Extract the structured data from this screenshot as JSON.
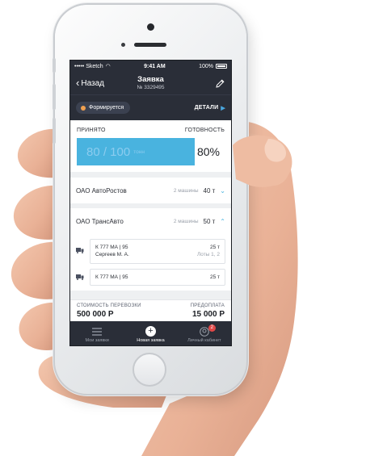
{
  "status_bar": {
    "carrier": "••••• Sketch",
    "time": "9:41 AM",
    "battery": "100%"
  },
  "nav": {
    "back_label": "Назад",
    "title": "Заявка",
    "subtitle": "№ 3329495"
  },
  "status_pill": {
    "label": "Формируется",
    "dot_color": "#f0a050"
  },
  "details_label": "ДЕТАЛИ",
  "summary": {
    "accepted_label": "ПРИНЯТО",
    "ready_label": "ГОТОВНОСТЬ",
    "progress_text": "80 / 100",
    "progress_unit": "тонн",
    "progress_percent": "80%",
    "progress_fraction": 0.8
  },
  "carriers": [
    {
      "name": "ОАО АвтоРостов",
      "count": "2 машины",
      "weight": "40 т",
      "expanded": false
    },
    {
      "name": "ОАО ТрансАвто",
      "count": "2 машины",
      "weight": "50 т",
      "expanded": true
    }
  ],
  "trucks": [
    {
      "plate": "К 777 МА | 95",
      "driver": "Сергеев М. А.",
      "weight": "25 т",
      "lots": "Лоты 1, 2"
    },
    {
      "plate": "К 777 МА | 95",
      "driver": "",
      "weight": "25 т",
      "lots": ""
    }
  ],
  "footer": {
    "cost_label": "СТОИМОСТЬ ПЕРЕВОЗКИ",
    "prepay_label": "ПРЕДОПЛАТА",
    "cost_value": "500 000 Р",
    "prepay_value": "15 000 Р"
  },
  "tabs": [
    {
      "label": "Мои заявки",
      "icon": "list-icon"
    },
    {
      "label": "Новая заявка",
      "icon": "plus-icon"
    },
    {
      "label": "Личный кабинет",
      "icon": "profile-icon",
      "badge": "2"
    }
  ],
  "colors": {
    "dark_bar": "#2a2e38",
    "accent": "#49b3df",
    "badge": "#e04848"
  }
}
